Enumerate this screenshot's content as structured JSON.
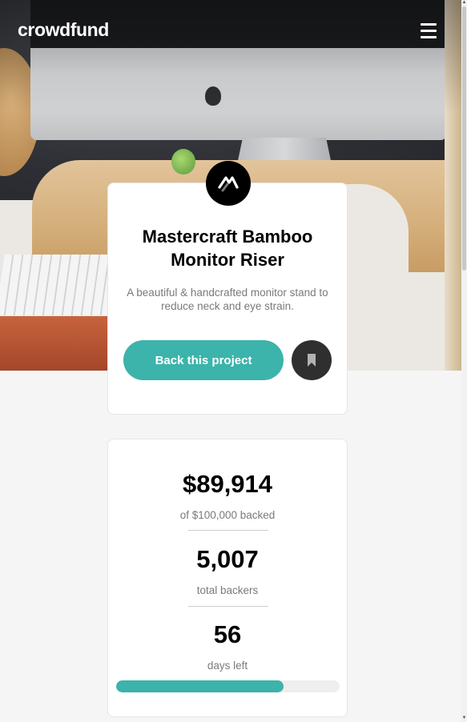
{
  "header": {
    "logo_text": "crowdfund",
    "menu_icon": "hamburger-menu-icon"
  },
  "hero": {
    "image_description_icon": "desk-monitor-photo"
  },
  "project": {
    "logo_icon": "mastercraft-logo-icon",
    "title": "Mastercraft Bamboo Monitor Riser",
    "description": "A beautiful & handcrafted monitor stand to reduce neck and eye strain.",
    "back_button_label": "Back this project",
    "bookmark_icon": "bookmark-icon"
  },
  "stats": {
    "amount_backed": "$89,914",
    "amount_backed_label": "of $100,000 backed",
    "total_backers": "5,007",
    "total_backers_label": "total backers",
    "days_left": "56",
    "days_left_label": "days left",
    "progress_fraction": 0.75
  },
  "colors": {
    "accent": "#3cb3ab",
    "dark": "#2f2f2f",
    "background": "#f5f5f5"
  }
}
